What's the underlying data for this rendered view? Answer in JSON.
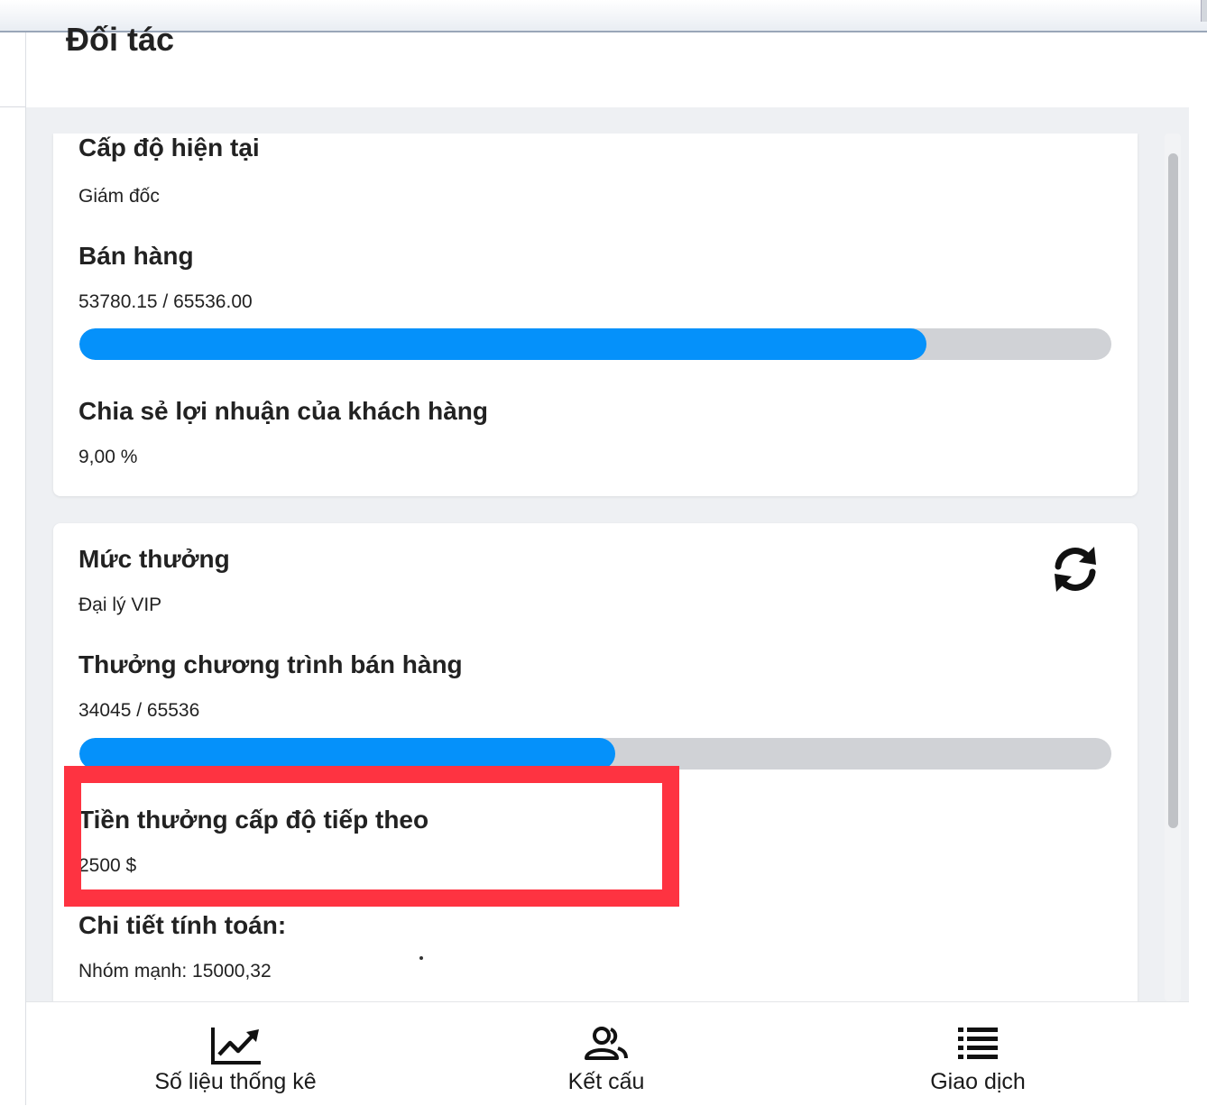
{
  "header": {
    "title": "Đối tác"
  },
  "level_card": {
    "current_level_label": "Cấp độ hiện tại",
    "current_level_value": "Giám đốc",
    "sales_label": "Bán hàng",
    "sales_value": "53780.15 / 65536.00",
    "sales_progress": 0.8206,
    "profit_share_label": "Chia sẻ lợi nhuận của khách hàng",
    "profit_share_value": "9,00 %"
  },
  "reward_card": {
    "reward_level_label": "Mức thưởng",
    "reward_level_value": "Đại lý VIP",
    "refresh_icon": "refresh-icon",
    "sales_program_label": "Thưởng chương trình bán hàng",
    "sales_program_value": "34045 / 65536",
    "sales_program_progress": 0.5195,
    "next_level_bonus_label": "Tiền thưởng cấp độ tiếp theo",
    "next_level_bonus_value": "2500 $",
    "calc_details_label": "Chi tiết tính toán:",
    "strong_group_value": "Nhóm mạnh: 15000,32"
  },
  "bottom_nav": {
    "items": [
      {
        "label": "Số liệu thống kê",
        "icon": "chart-line-icon"
      },
      {
        "label": "Kết cấu",
        "icon": "users-icon"
      },
      {
        "label": "Giao dịch",
        "icon": "list-icon"
      }
    ]
  },
  "colors": {
    "progress_fill": "#0591fa",
    "progress_track": "#d0d2d6",
    "highlight": "#fe3341",
    "background": "#eef0f3"
  }
}
